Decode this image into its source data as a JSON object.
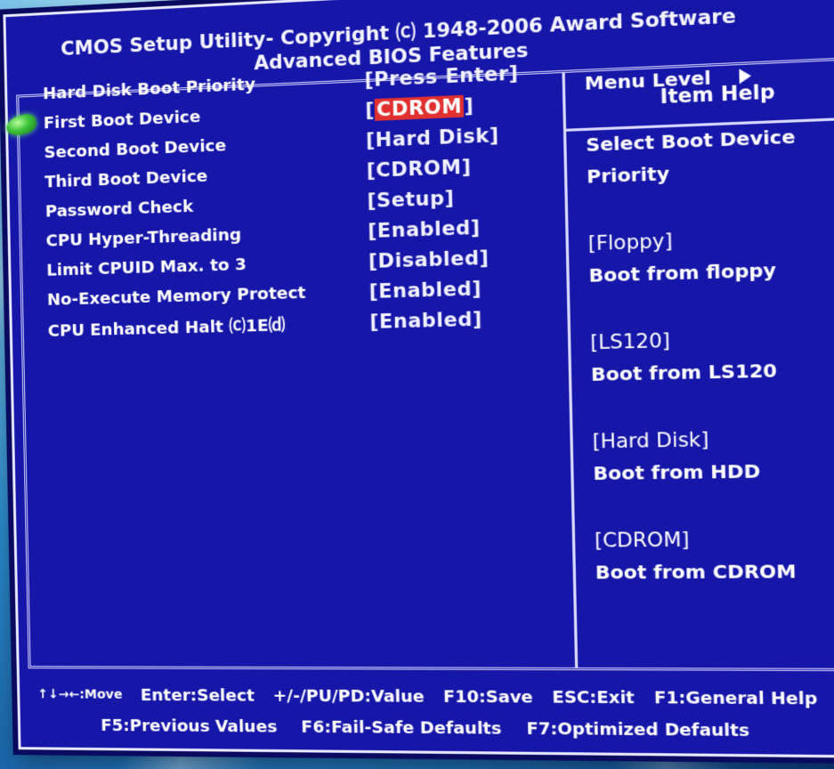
{
  "header": {
    "line1": "CMOS Setup Utility- Copyright ⒞ 1948-2006 Award Software",
    "line2": "Advanced BIOS Features"
  },
  "help_panel": {
    "title": "Item Help",
    "menu_level": "Menu Level",
    "lines": [
      "Select Boot Device",
      "Priority"
    ],
    "options": [
      {
        "key": "[Floppy]",
        "desc": "Boot from floppy"
      },
      {
        "key": "[LS120]",
        "desc": "Boot from LS120"
      },
      {
        "key": "[Hard Disk]",
        "desc": "Boot from HDD"
      },
      {
        "key": "[CDROM]",
        "desc": "Boot from CDROM"
      }
    ]
  },
  "settings": [
    {
      "name": "Hard Disk Boot Priority",
      "value": "Press Enter"
    },
    {
      "name": "First Boot Device",
      "value": "CDROM",
      "selected": true
    },
    {
      "name": "Second Boot Device",
      "value": "Hard Disk"
    },
    {
      "name": "Third Boot Device",
      "value": "CDROM"
    },
    {
      "name": "Password Check",
      "value": "Setup"
    },
    {
      "name": "CPU Hyper-Threading",
      "value": "Enabled"
    },
    {
      "name": "Limit CPUID Max. to 3",
      "value": "Disabled"
    },
    {
      "name": "No-Execute Memory Protect",
      "value": "Enabled"
    },
    {
      "name": "CPU Enhanced Halt ⒞1E⒟",
      "value": "Enabled"
    }
  ],
  "footer": {
    "move": "↑↓→←:Move",
    "select": "Enter:Select",
    "value": "+/-/PU/PD:Value",
    "save": "F10:Save",
    "exit": "ESC:Exit",
    "help": "F1:General Help",
    "prev": "F5:Previous Values",
    "failsafe": "F6:Fail-Safe Defaults",
    "optimized": "F7:Optimized Defaults"
  },
  "colors": {
    "screen_bg": "#1616a8",
    "selected_bg": "#e03030",
    "text": "#ffffff"
  }
}
